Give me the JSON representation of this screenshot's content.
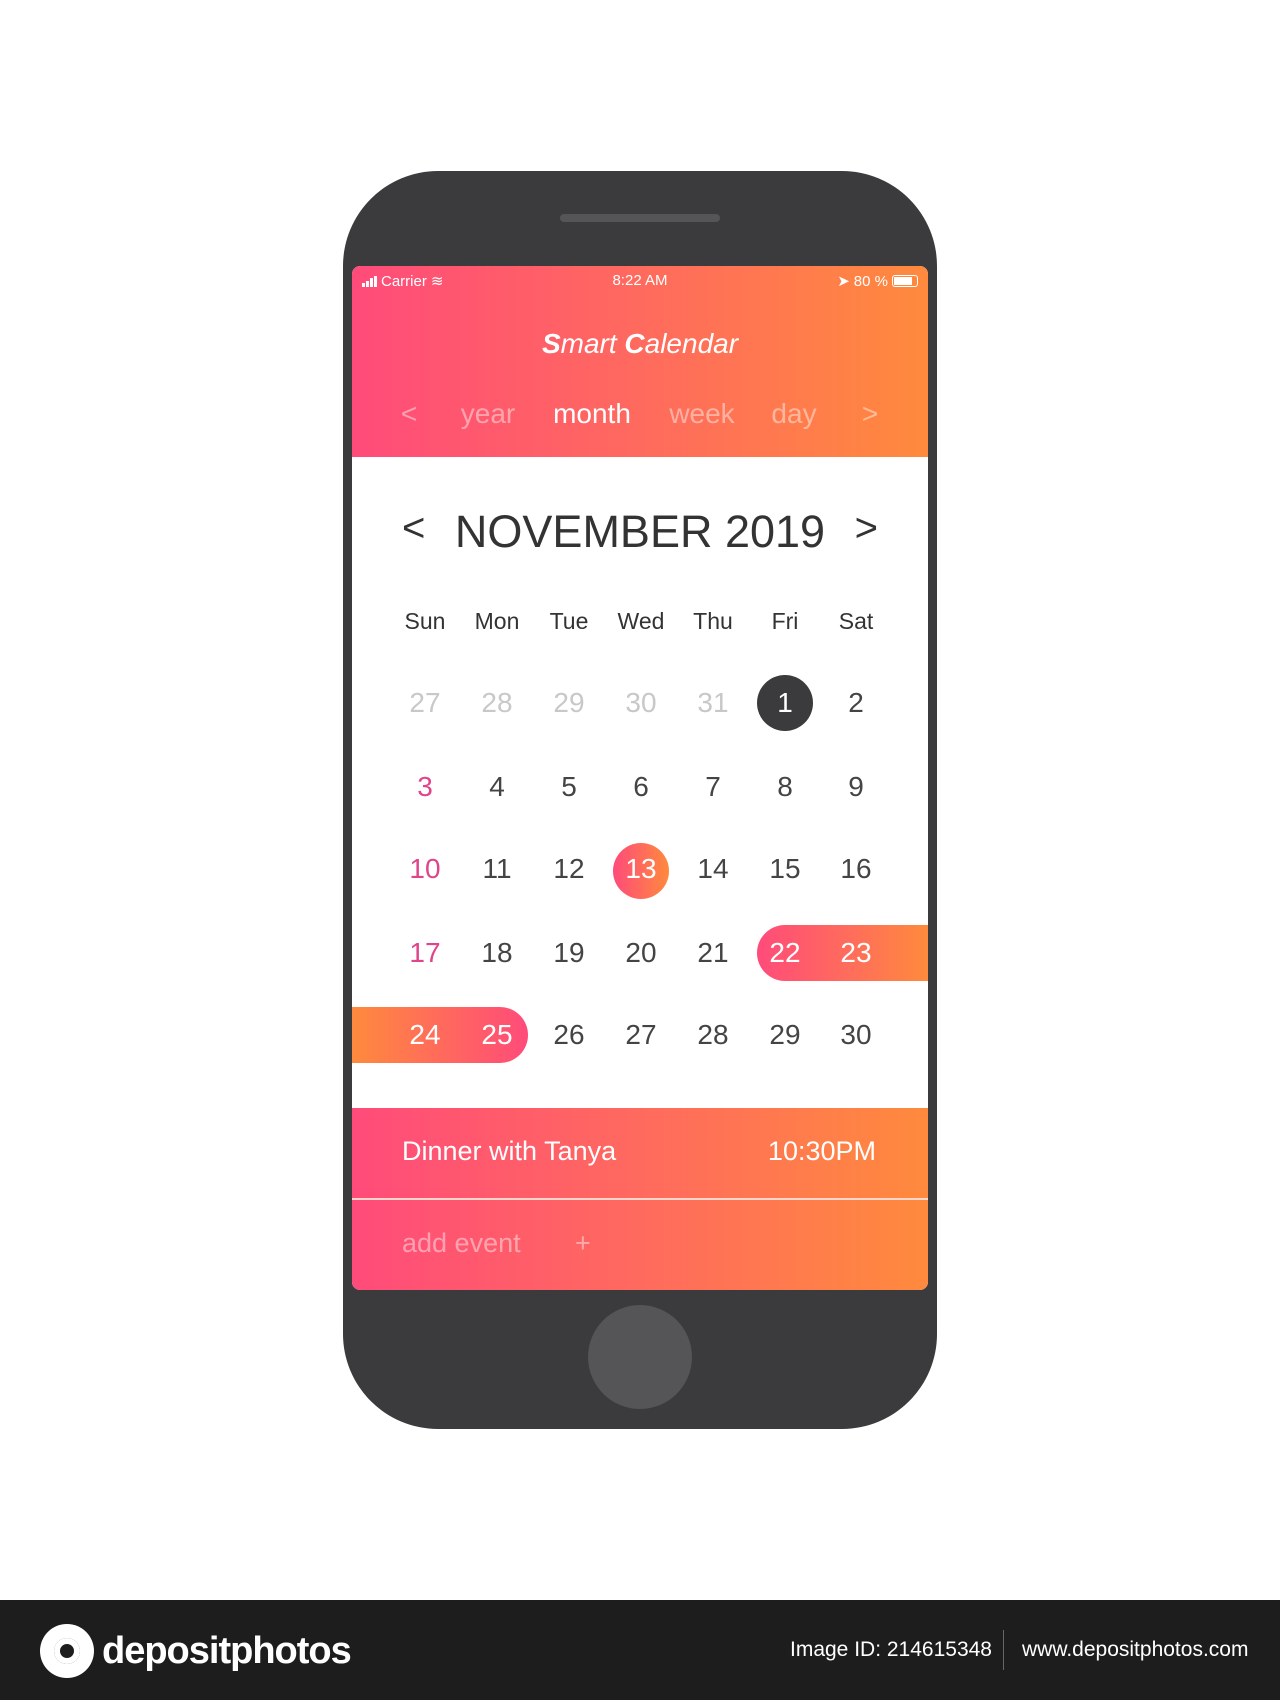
{
  "status_bar": {
    "carrier": "Carrier",
    "time": "8:22 AM",
    "battery": "80 %",
    "battery_level": 0.8
  },
  "app": {
    "title_s": "S",
    "title_mart": "mart ",
    "title_c": "C",
    "title_alendar": "alendar"
  },
  "view_tabs": {
    "prev": "<",
    "next": ">",
    "items": [
      {
        "label": "year"
      },
      {
        "label": "month",
        "active": true
      },
      {
        "label": "week"
      },
      {
        "label": "day"
      }
    ]
  },
  "calendar": {
    "month_label": "NOVEMBER 2019",
    "prev": "<",
    "next": ">",
    "weekdays": [
      "Sun",
      "Mon",
      "Tue",
      "Wed",
      "Thu",
      "Fri",
      "Sat"
    ],
    "weeks": [
      [
        "27",
        "28",
        "29",
        "30",
        "31",
        "1",
        "2"
      ],
      [
        "3",
        "4",
        "5",
        "6",
        "7",
        "8",
        "9"
      ],
      [
        "10",
        "11",
        "12",
        "13",
        "14",
        "15",
        "16"
      ],
      [
        "17",
        "18",
        "19",
        "20",
        "21",
        "22",
        "23"
      ],
      [
        "24",
        "25",
        "26",
        "27",
        "28",
        "29",
        "30"
      ]
    ],
    "selected_day": "1",
    "today": "13",
    "range": [
      "22",
      "23",
      "24",
      "25"
    ],
    "colors": {
      "accent_start": "#ff4b7a",
      "accent_end": "#ff8a3d",
      "sunday": "#e0448a",
      "selected": "#3b3b3d"
    }
  },
  "event": {
    "name": "Dinner with Tanya",
    "time": "10:30PM"
  },
  "add_event": {
    "label": "add event",
    "plus": "+"
  },
  "footer": {
    "brand": "depositphotos",
    "image_id": "Image ID: 214615348",
    "url": "www.depositphotos.com"
  }
}
